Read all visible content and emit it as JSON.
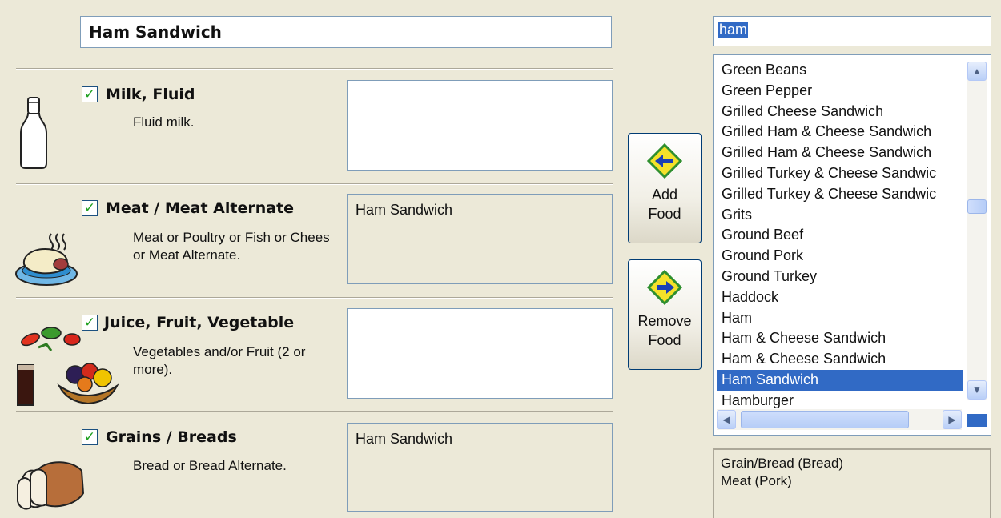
{
  "meal_name": "Ham Sandwich",
  "categories": [
    {
      "key": "milk",
      "title": "Milk, Fluid",
      "description": "Fluid milk.",
      "checked": true,
      "food": "",
      "icon": "milk-bottle-icon"
    },
    {
      "key": "meat",
      "title": "Meat / Meat Alternate",
      "description": "Meat or Poultry or Fish or Chees or Meat Alternate.",
      "checked": true,
      "food": "Ham Sandwich",
      "icon": "meat-plate-icon"
    },
    {
      "key": "fruitveg",
      "title": "Juice, Fruit, Vegetable",
      "description": "Vegetables and/or Fruit (2 or more).",
      "checked": true,
      "food": "",
      "icon": "fruit-vegetable-icon"
    },
    {
      "key": "grains",
      "title": "Grains / Breads",
      "description": "Bread or Bread Alternate.",
      "checked": true,
      "food": "Ham Sandwich",
      "icon": "bread-icon"
    }
  ],
  "checkmark": "✓",
  "buttons": {
    "add_food": {
      "line1": "Add",
      "line2": "Food",
      "icon": "arrow-left-icon"
    },
    "remove_food": {
      "line1": "Remove",
      "line2": "Food",
      "icon": "arrow-right-icon"
    }
  },
  "search": {
    "value": "ham"
  },
  "food_list": {
    "items": [
      "Green Beans",
      "Green Pepper",
      "Grilled Cheese Sandwich",
      "Grilled Ham & Cheese Sandwich",
      "Grilled Ham & Cheese Sandwich",
      "Grilled Turkey & Cheese Sandwic",
      "Grilled Turkey & Cheese Sandwic",
      "Grits",
      "Ground Beef",
      "Ground Pork",
      "Ground Turkey",
      "Haddock",
      "Ham",
      "Ham & Cheese Sandwich",
      "Ham & Cheese Sandwich",
      "Ham Sandwich",
      "Hamburger"
    ],
    "selected": "Ham Sandwich",
    "scroll_up": "▲",
    "scroll_down": "▼",
    "scroll_left": "◀",
    "scroll_right": "▶"
  },
  "selected_food_categories": [
    "Grain/Bread (Bread)",
    "Meat (Pork)"
  ],
  "colors": {
    "accent": "#316ac5",
    "arrow_fill": "#1a3fb5",
    "diamond_fill": "#f4e12a",
    "diamond_border": "#2f8f2f"
  }
}
